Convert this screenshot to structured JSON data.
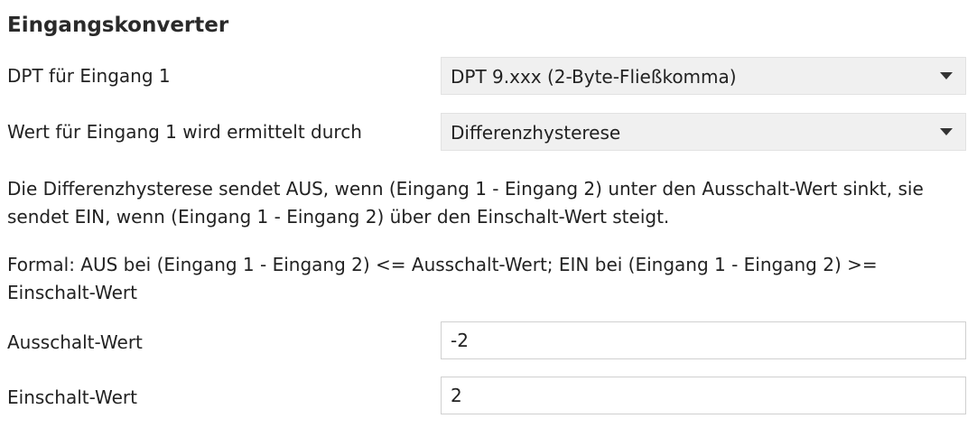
{
  "section": {
    "title": "Eingangskonverter"
  },
  "fields": {
    "dpt_input1": {
      "label": "DPT für Eingang 1",
      "value": "DPT 9.xxx (2-Byte-Fließkomma)"
    },
    "value_mode": {
      "label": "Wert für Eingang 1 wird ermittelt durch",
      "value": "Differenzhysterese"
    },
    "off_value": {
      "label": "Ausschalt-Wert",
      "value": "-2"
    },
    "on_value": {
      "label": "Einschalt-Wert",
      "value": "2"
    }
  },
  "description": {
    "text": "Die Differenzhysterese sendet AUS, wenn (Eingang 1 - Eingang 2) unter den Ausschalt-Wert sinkt, sie sendet EIN, wenn (Eingang 1 - Eingang 2) über den Einschalt-Wert steigt.",
    "formula": "Formal: AUS bei (Eingang 1 - Eingang 2) <= Ausschalt-Wert; EIN bei (Eingang 1 - Eingang 2) >= Einschalt-Wert"
  },
  "icons": {
    "dropdown": "caret-down-icon"
  },
  "colors": {
    "select_bg": "#f0f0f0",
    "text": "#222222"
  }
}
